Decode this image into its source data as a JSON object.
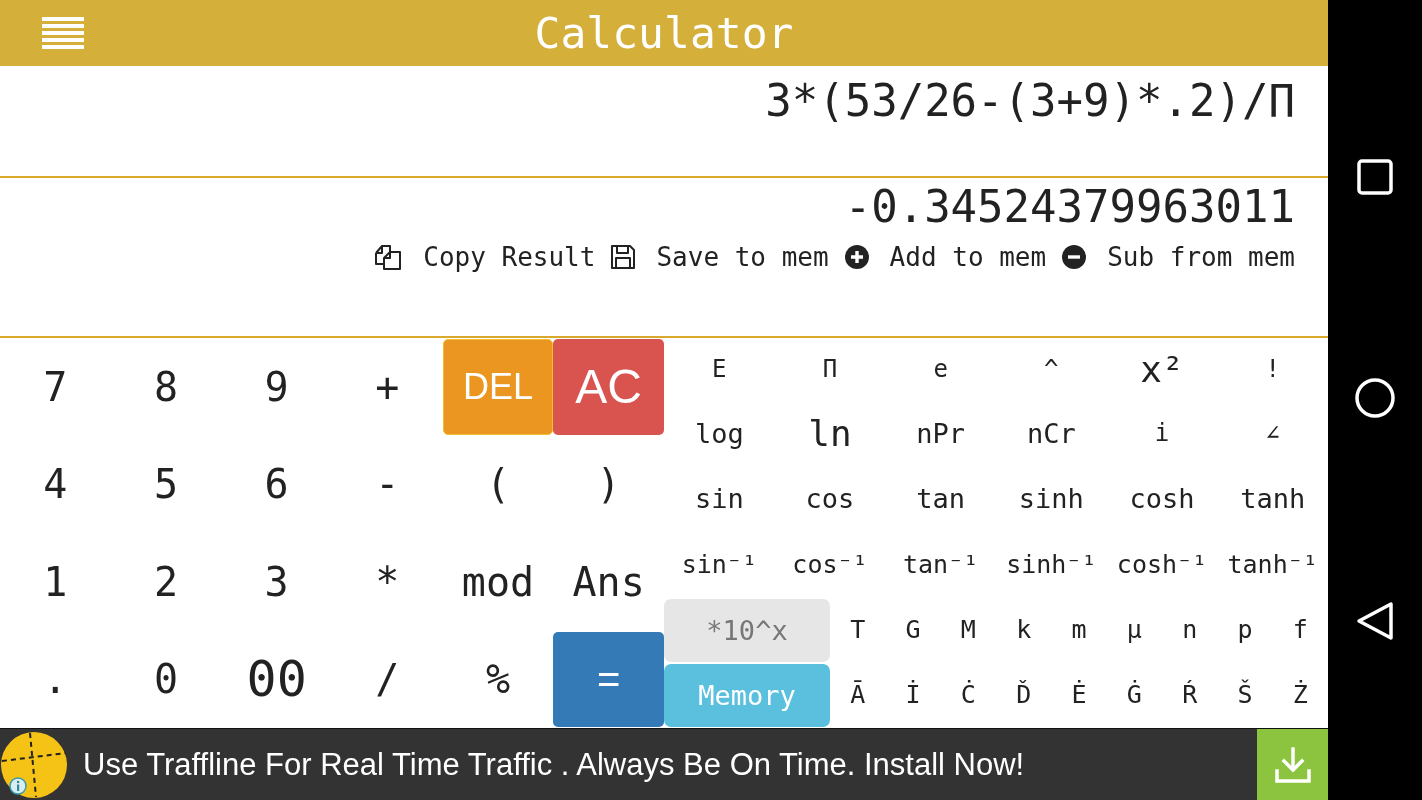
{
  "header": {
    "title": "Calculator"
  },
  "display": {
    "expression": "3*(53/26-(3+9)*.2)/Π",
    "result": "-0.34524379963011",
    "actions": [
      {
        "kind": "copy",
        "label": "Copy Result"
      },
      {
        "kind": "save",
        "label": "Save to mem"
      },
      {
        "kind": "add",
        "label": "Add to mem"
      },
      {
        "kind": "subtract",
        "label": "Sub from mem"
      }
    ]
  },
  "keypad": {
    "main_keys": [
      {
        "label": "7",
        "kind": "plain",
        "focused": false
      },
      {
        "label": "8",
        "kind": "plain",
        "focused": false
      },
      {
        "label": "9",
        "kind": "plain",
        "focused": false
      },
      {
        "label": "+",
        "kind": "plain",
        "focused": false
      },
      {
        "label": "DEL",
        "kind": "delete",
        "focused": true
      },
      {
        "label": "AC",
        "kind": "clear",
        "focused": false
      },
      {
        "label": "4",
        "kind": "plain",
        "focused": false
      },
      {
        "label": "5",
        "kind": "plain",
        "focused": false
      },
      {
        "label": "6",
        "kind": "plain",
        "focused": false
      },
      {
        "label": "-",
        "kind": "plain",
        "focused": false
      },
      {
        "label": "(",
        "kind": "plain",
        "focused": false
      },
      {
        "label": ")",
        "kind": "plain",
        "focused": false
      },
      {
        "label": "1",
        "kind": "plain",
        "focused": false
      },
      {
        "label": "2",
        "kind": "plain",
        "focused": false
      },
      {
        "label": "3",
        "kind": "plain",
        "focused": false
      },
      {
        "label": "*",
        "kind": "plain",
        "focused": false
      },
      {
        "label": "mod",
        "kind": "plain",
        "focused": false
      },
      {
        "label": "Ans",
        "kind": "plain",
        "focused": false
      },
      {
        "label": ".",
        "kind": "plain",
        "focused": false
      },
      {
        "label": "0",
        "kind": "plain",
        "focused": false
      },
      {
        "label": "00",
        "kind": "large",
        "focused": false
      },
      {
        "label": "/",
        "kind": "plain",
        "focused": false
      },
      {
        "label": "%",
        "kind": "plain",
        "focused": false
      },
      {
        "label": "=",
        "kind": "equals",
        "focused": false
      }
    ],
    "function_keys": [
      {
        "label": "E",
        "kind": "symbol"
      },
      {
        "label": "Π",
        "kind": "symbol"
      },
      {
        "label": "e",
        "kind": "symbol"
      },
      {
        "label": "^",
        "kind": "symbol"
      },
      {
        "label": "x²",
        "kind": "large"
      },
      {
        "label": "!",
        "kind": "symbol"
      },
      {
        "label": "log",
        "kind": "function"
      },
      {
        "label": "ln",
        "kind": "large"
      },
      {
        "label": "nPr",
        "kind": "function"
      },
      {
        "label": "nCr",
        "kind": "function"
      },
      {
        "label": "i",
        "kind": "symbol"
      },
      {
        "label": "∠",
        "kind": "symbol"
      },
      {
        "label": "sin",
        "kind": "function"
      },
      {
        "label": "cos",
        "kind": "function"
      },
      {
        "label": "tan",
        "kind": "function"
      },
      {
        "label": "sinh",
        "kind": "function"
      },
      {
        "label": "cosh",
        "kind": "function"
      },
      {
        "label": "tanh",
        "kind": "function"
      },
      {
        "label": "sin⁻¹",
        "kind": "inverse"
      },
      {
        "label": "cos⁻¹",
        "kind": "inverse"
      },
      {
        "label": "tan⁻¹",
        "kind": "inverse"
      },
      {
        "label": "sinh⁻¹",
        "kind": "inverse"
      },
      {
        "label": "cosh⁻¹",
        "kind": "inverse"
      },
      {
        "label": "tanh⁻¹",
        "kind": "inverse"
      }
    ],
    "wide_keys": [
      {
        "label": "*10^x",
        "kind": "neutral"
      },
      {
        "label": "Memory",
        "kind": "memory"
      }
    ],
    "prefix_keys": [
      "T",
      "G",
      "M",
      "k",
      "m",
      "μ",
      "n",
      "p",
      "f"
    ],
    "letter_keys": [
      "Ā",
      "İ",
      "Ċ",
      "Ď",
      "Ė",
      "Ġ",
      "Ŕ",
      "Š",
      "Ż"
    ]
  },
  "ad": {
    "text": "Use Traffline For Real Time Traffic . Always Be On Time. Install Now!"
  }
}
